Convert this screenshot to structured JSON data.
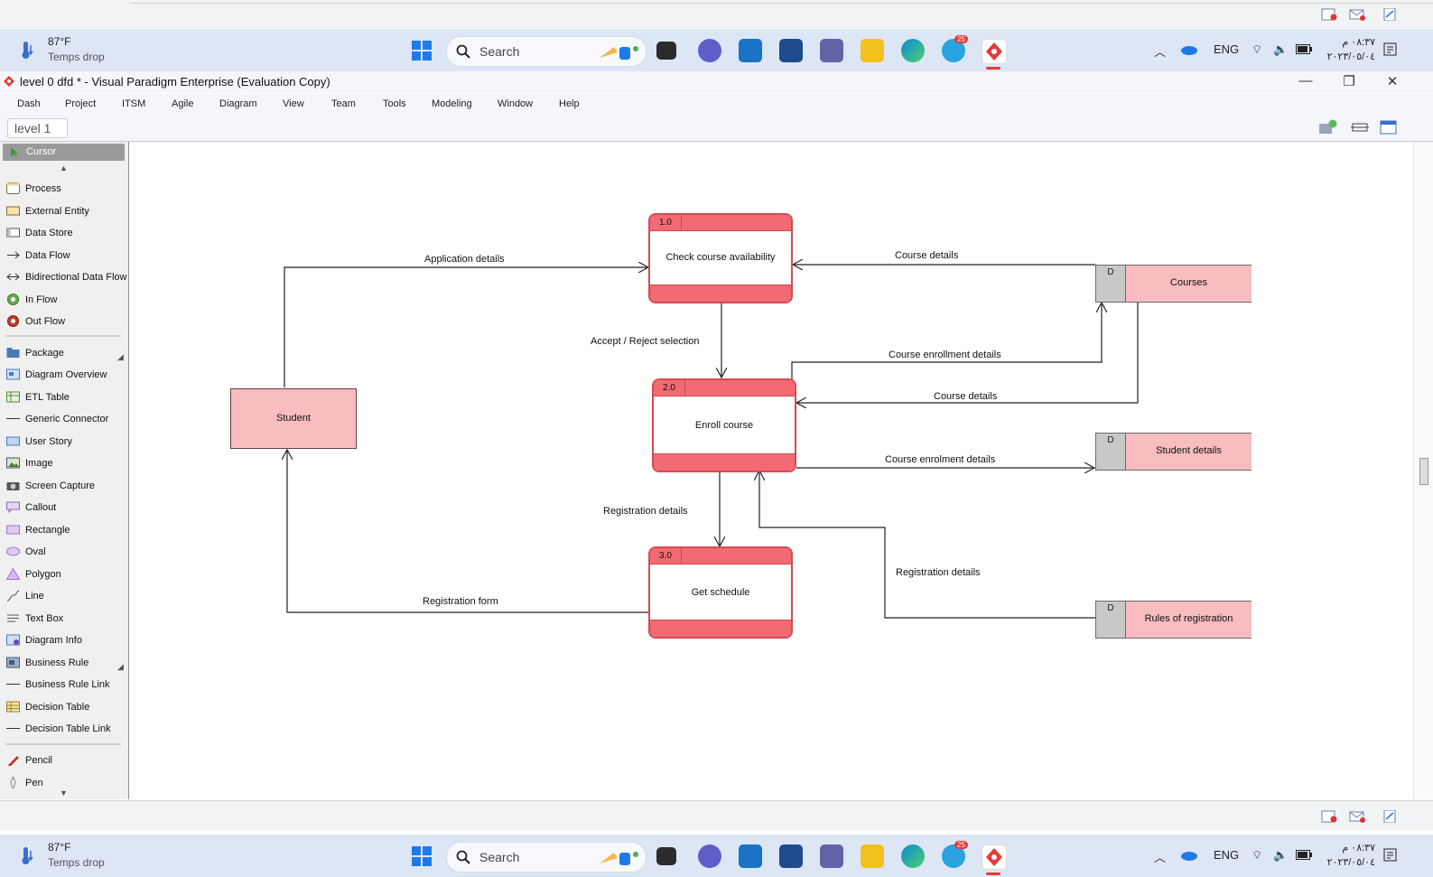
{
  "os": {
    "weather": {
      "temp": "87°F",
      "condition": "Temps drop"
    },
    "search_label": "Search",
    "language": "ENG",
    "clock": {
      "time": "٠٨:٣٧ م",
      "date": "٢٠٢٣/٠٥/٠٤"
    },
    "telegram_badge": "25"
  },
  "app": {
    "title": "level 0 dfd  * - Visual Paradigm Enterprise (Evaluation Copy)",
    "menu": [
      "Dash",
      "Project",
      "ITSM",
      "Agile",
      "Diagram",
      "View",
      "Team",
      "Tools",
      "Modeling",
      "Window",
      "Help"
    ],
    "breadcrumb": "level 1"
  },
  "palette": {
    "cursor": "Cursor",
    "group1": [
      "Process",
      "External Entity",
      "Data Store",
      "Data Flow",
      "Bidirectional Data Flow",
      "In Flow",
      "Out Flow"
    ],
    "group2": [
      "Package",
      "Diagram Overview",
      "ETL Table",
      "Generic Connector",
      "User Story",
      "Image",
      "Screen Capture",
      "Callout",
      "Rectangle",
      "Oval",
      "Polygon",
      "Line",
      "Text Box",
      "Diagram Info",
      "Business Rule",
      "Business Rule Link",
      "Decision Table",
      "Decision Table Link"
    ],
    "group3": [
      "Pencil",
      "Pen"
    ]
  },
  "diagram": {
    "processes": [
      {
        "id": "1.0",
        "name": "Check course availability"
      },
      {
        "id": "2.0",
        "name": "Enroll course"
      },
      {
        "id": "3.0",
        "name": "Get schedule"
      }
    ],
    "entity": "Student",
    "stores": [
      {
        "tag": "D",
        "name": "Courses"
      },
      {
        "tag": "D",
        "name": "Student details"
      },
      {
        "tag": "D",
        "name": "Rules of registration"
      }
    ],
    "flows": {
      "application_details": "Application details",
      "course_details_1": "Course details",
      "accept_reject": "Accept / Reject selection",
      "course_enrollment_details": "Course enrollment details",
      "course_details_2": "Course details",
      "course_enrolment_details": "Course enrolment details",
      "registration_details_1": "Registration details",
      "registration_details_2": "Registration details",
      "registration_form": "Registration form"
    }
  }
}
